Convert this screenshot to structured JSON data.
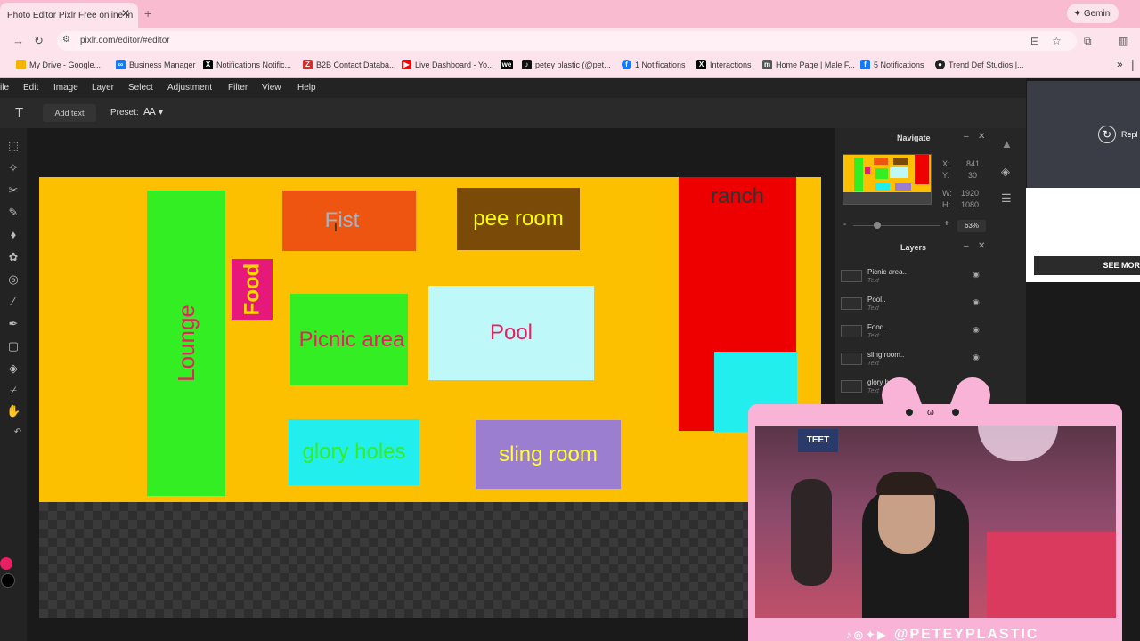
{
  "browser": {
    "tab_title": "Photo Editor Pixlr Free online In",
    "tab_close": "✕",
    "new_tab": "+",
    "gemini_label": "Gemini",
    "url": "pixlr.com/editor/#editor",
    "bookmarks": [
      {
        "label": "My Drive - Google...",
        "icon": "google-drive-icon"
      },
      {
        "label": "Business Manager",
        "icon": "meta-icon"
      },
      {
        "label": "Notifications Notific...",
        "icon": "x-icon"
      },
      {
        "label": "B2B Contact Databa...",
        "icon": "zoominfo-icon"
      },
      {
        "label": "Live Dashboard - Yo...",
        "icon": "youtube-icon"
      },
      {
        "label": "",
        "icon": "we-icon"
      },
      {
        "label": "petey plastic (@pet...",
        "icon": "tiktok-icon"
      },
      {
        "label": "1 Notifications",
        "icon": "facebook-icon"
      },
      {
        "label": "Interactions",
        "icon": "x-icon"
      },
      {
        "label": "Home Page | Male F...",
        "icon": "site-icon"
      },
      {
        "label": "5 Notifications",
        "icon": "facebook-icon"
      },
      {
        "label": "Trend Def Studios |...",
        "icon": "site-icon"
      }
    ],
    "bookmarks_more": "»"
  },
  "pixlr": {
    "menu": [
      "ile",
      "Edit",
      "Image",
      "Layer",
      "Select",
      "Adjustment",
      "Filter",
      "View",
      "Help"
    ],
    "options": {
      "tool_icon": "T",
      "add_text": "Add text",
      "preset_label": "Preset:",
      "preset_value": "Ꜳ ▾"
    },
    "canvas_blocks": [
      {
        "id": "lounge",
        "label": "Lounge",
        "color": "#33ee22",
        "text_color": "#e91e63"
      },
      {
        "id": "food",
        "label": "Food",
        "color": "#e6197a",
        "text_color": "#ffd700"
      },
      {
        "id": "fist",
        "label": "Fist",
        "color": "#ee5511",
        "text_color": "#9fb4c8"
      },
      {
        "id": "pee-room",
        "label": "pee room",
        "color": "#7a4a08",
        "text_color": "#ffff00"
      },
      {
        "id": "ranch",
        "label": "ranch",
        "color": "#ee0000",
        "text_color": "#333333"
      },
      {
        "id": "picnic-area",
        "label": "Picnic area",
        "color": "#33ee22",
        "text_color": "#e91e63"
      },
      {
        "id": "pool",
        "label": "Pool",
        "color": "#bff8f8",
        "text_color": "#e91e63"
      },
      {
        "id": "glory-holes",
        "label": "glory holes",
        "color": "#22eeee",
        "text_color": "#33ee22"
      },
      {
        "id": "sling-room",
        "label": "sling room",
        "color": "#9c7ed0",
        "text_color": "#ffff33"
      },
      {
        "id": "cyan-block",
        "label": "",
        "color": "#22eeee",
        "text_color": "#000000"
      }
    ],
    "navigate": {
      "title": "Navigate",
      "x_label": "X:",
      "x_value": "841",
      "y_label": "Y:",
      "y_value": "30",
      "w_label": "W:",
      "w_value": "1920",
      "h_label": "H:",
      "h_value": "1080",
      "zoom": "63%",
      "minus": "-",
      "plus": "+"
    },
    "layers": {
      "title": "Layers",
      "items": [
        {
          "name": "Picnic area..",
          "type": "Text"
        },
        {
          "name": "Pool..",
          "type": "Text"
        },
        {
          "name": "Food..",
          "type": "Text"
        },
        {
          "name": "sling room..",
          "type": "Text"
        },
        {
          "name": "glory h...",
          "type": "Text"
        }
      ]
    }
  },
  "ad": {
    "replay": "Repl",
    "see_more": "SEE MOR"
  },
  "overlay": {
    "handle": "@PETEYPLASTIC",
    "cam_sign": "TEET"
  }
}
